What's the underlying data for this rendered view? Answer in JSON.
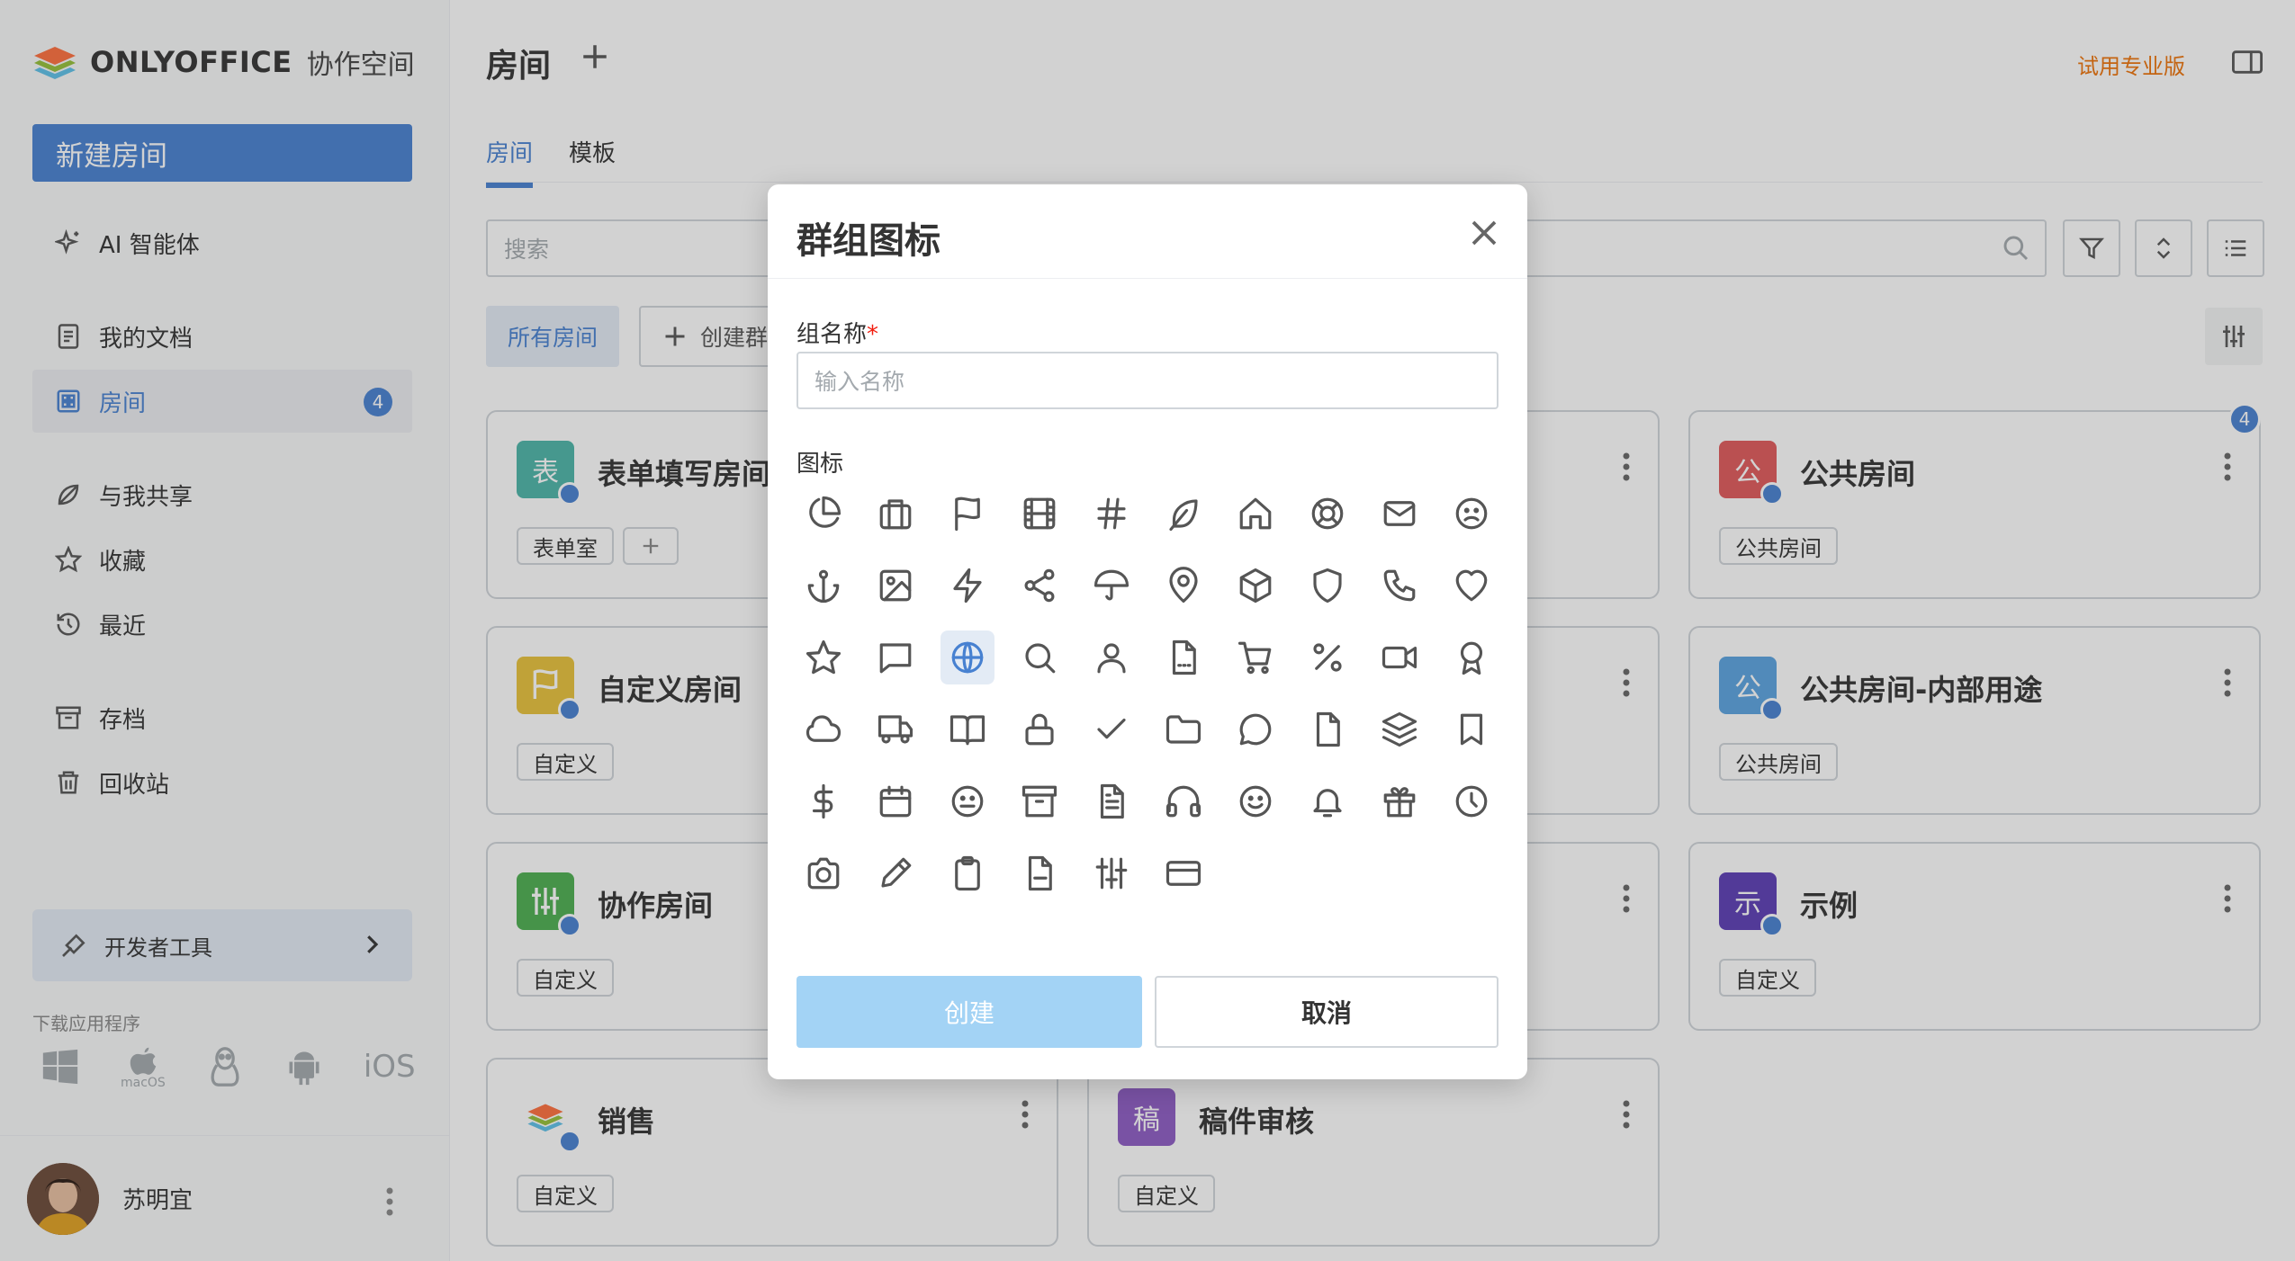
{
  "sidebar": {
    "logo_text": "ONLYOFFICE",
    "logo_sub": "协作空间",
    "new_room": "新建房间",
    "items": [
      {
        "label": "AI 智能体"
      },
      {
        "label": "我的文档"
      },
      {
        "label": "房间",
        "badge": "4"
      },
      {
        "label": "与我共享"
      },
      {
        "label": "收藏"
      },
      {
        "label": "最近"
      },
      {
        "label": "存档"
      },
      {
        "label": "回收站"
      }
    ],
    "dev_tools": "开发者工具",
    "download_label": "下载应用程序",
    "os": [
      "Windows",
      "macOS",
      "Linux",
      "Android",
      "iOS"
    ],
    "user_name": "苏明宜"
  },
  "header": {
    "title": "房间",
    "trial": "试用专业版",
    "tabs": [
      "房间",
      "模板"
    ]
  },
  "toolbar": {
    "search_placeholder": "搜索",
    "all_rooms": "所有房间",
    "create_group": "创建群组"
  },
  "cards": [
    {
      "title": "表单填写房间",
      "letter": "表",
      "color": "#4cb5a8",
      "tag": "表单室"
    },
    {
      "title": "公共房间",
      "letter": "公",
      "color": "#e0595a",
      "tag": "公共房间",
      "badge": "4"
    },
    {
      "title": "自定义房间",
      "letter": "",
      "color": "#e8c23a",
      "tag": "自定义"
    },
    {
      "title": "公共房间-内部用途",
      "letter": "公",
      "color": "#5aa3e0",
      "tag": "公共房间"
    },
    {
      "title": "协作房间",
      "letter": "",
      "color": "#4caf50",
      "tag": "自定义"
    },
    {
      "title": "示例",
      "letter": "示",
      "color": "#5b3db5",
      "tag": "自定义"
    },
    {
      "title": "销售",
      "letter": "",
      "color": "#ffffff",
      "tag": "自定义"
    },
    {
      "title": "稿件审核",
      "letter": "稿",
      "color": "#8e5cc4",
      "tag": "自定义"
    }
  ],
  "modal": {
    "title": "群组图标",
    "name_label": "组名称",
    "required_mark": "*",
    "name_placeholder": "输入名称",
    "icons_label": "图标",
    "icons": [
      "pie-chart",
      "briefcase",
      "flag",
      "film",
      "hash",
      "feather",
      "home",
      "life-buoy",
      "mail",
      "frown",
      "anchor",
      "image",
      "zap",
      "share",
      "umbrella",
      "map-pin",
      "box",
      "shield",
      "phone",
      "heart",
      "star",
      "message-square",
      "globe",
      "search",
      "user",
      "file",
      "shopping-cart",
      "percent",
      "video",
      "award",
      "cloud",
      "truck",
      "book-open",
      "lock",
      "check",
      "folder",
      "message-circle",
      "file-blank",
      "layers",
      "bookmark",
      "dollar",
      "calendar",
      "meh",
      "archive",
      "file-text",
      "headphones",
      "smile",
      "bell",
      "gift",
      "clock",
      "camera",
      "edit",
      "clipboard",
      "file-minus",
      "sliders",
      "credit-card"
    ],
    "selected_icon": "globe",
    "create": "创建",
    "cancel": "取消"
  }
}
